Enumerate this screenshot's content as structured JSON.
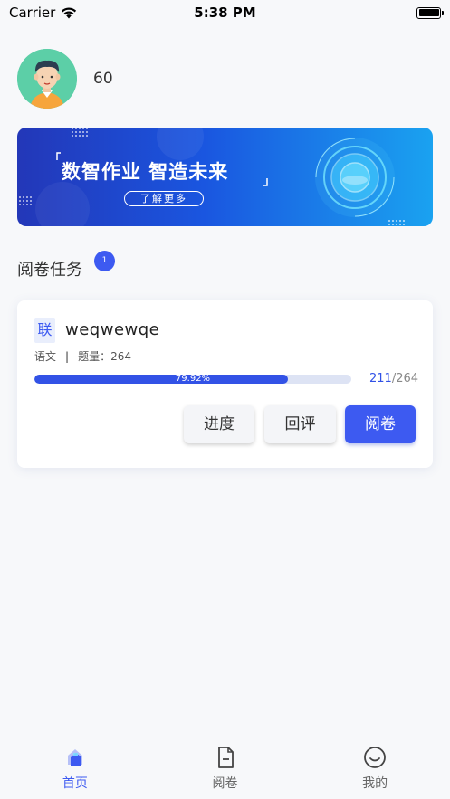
{
  "status_bar": {
    "carrier": "Carrier",
    "time": "5:38 PM"
  },
  "profile": {
    "score": "60"
  },
  "banner": {
    "title": "数智作业 智造未来",
    "button_label": "了解更多"
  },
  "section": {
    "title": "阅卷任务",
    "badge_count": "1"
  },
  "task": {
    "tag": "联",
    "name": "weqwewqe",
    "subject": "语文",
    "separator": "|",
    "question_count_label": "题量：264",
    "progress_percent_label": "79.92%",
    "progress_fraction": 0.7992,
    "done_count": "211",
    "total_count": "/264",
    "buttons": {
      "progress_label": "进度",
      "review_label": "回评",
      "grade_label": "阅卷"
    }
  },
  "tab_bar": {
    "tabs": [
      {
        "label": "首页",
        "icon": "home-icon",
        "active": true
      },
      {
        "label": "阅卷",
        "icon": "document-icon",
        "active": false
      },
      {
        "label": "我的",
        "icon": "smiley-icon",
        "active": false
      }
    ]
  },
  "colors": {
    "accent": "#3d5af1",
    "background": "#f7f8fa"
  }
}
